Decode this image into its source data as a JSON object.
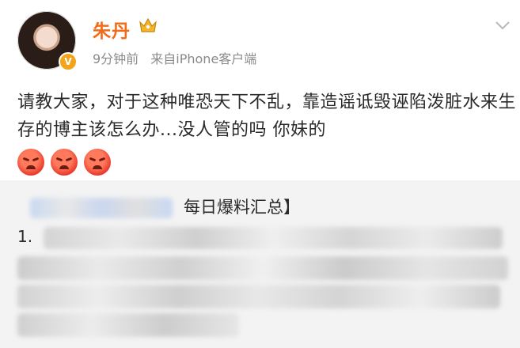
{
  "post": {
    "username": "朱丹",
    "time_ago": "9分钟前",
    "source": "来自iPhone客户端",
    "text": "请教大家，对于这种唯恐天下不乱，靠造谣诋毁诬陷泼脏水来生存的博主该怎么办...没人管的吗 你妹的",
    "emoji_count": 3,
    "icons": {
      "crown": "crown-icon",
      "badge": "verified-badge-icon",
      "menu": "chevron-down-icon",
      "emoji": "angry-face-icon"
    }
  },
  "repost": {
    "title_fragment": "每日爆料汇总】",
    "line1_prefix": "1."
  },
  "colors": {
    "username": "#f26b1a",
    "meta": "#8a8a8a",
    "repost_bg": "#f3f3f3"
  }
}
